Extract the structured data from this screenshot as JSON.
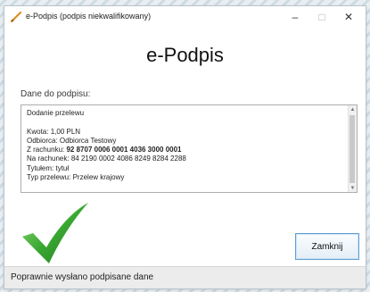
{
  "window": {
    "title": "e-Podpis (podpis niekwalifikowany)",
    "controls": {
      "minimize": "–",
      "maximize": "□",
      "close": "✕"
    }
  },
  "app_title": "e-Podpis",
  "section_label": "Dane do podpisu:",
  "details": {
    "header": "Dodanie przelewu",
    "lines": [
      {
        "label": "Kwota:",
        "value": "1,00 PLN",
        "bold": false
      },
      {
        "label": "Odbiorca:",
        "value": "Odbiorca Testowy",
        "bold": false
      },
      {
        "label": "Z rachunku:",
        "value": "92 8707 0006 0001 4036 3000 0001",
        "bold": true
      },
      {
        "label": "Na rachunek:",
        "value": "84 2190 0002 4086 8249 8284 2288",
        "bold": false
      },
      {
        "label": "Tytułem:",
        "value": "tytuł",
        "bold": false
      },
      {
        "label": "Typ przelewu:",
        "value": "Przelew krajowy",
        "bold": false
      }
    ]
  },
  "icons": {
    "app_icon": "pen-icon",
    "success_icon": "checkmark-icon",
    "colors": {
      "check_green": "#3aa832",
      "pen_orange": "#e08a1e",
      "button_border": "#5e9fd2"
    }
  },
  "buttons": {
    "close_label": "Zamknij"
  },
  "status_text": "Poprawnie wysłano podpisane dane"
}
